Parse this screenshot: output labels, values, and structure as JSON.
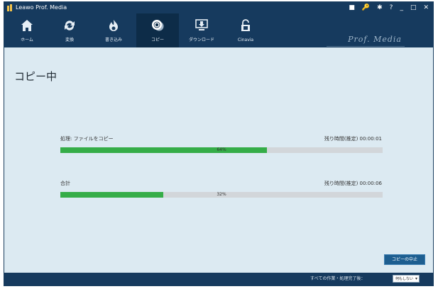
{
  "window": {
    "title": "Leawo Prof. Media"
  },
  "titlebar_icons": [
    {
      "name": "chat-icon",
      "glyph": "■"
    },
    {
      "name": "key-icon",
      "glyph": "🔑"
    },
    {
      "name": "settings-gear-icon",
      "glyph": "✱"
    },
    {
      "name": "help-icon",
      "glyph": "?"
    },
    {
      "name": "minimize-icon",
      "glyph": "_"
    },
    {
      "name": "maximize-icon",
      "glyph": "□"
    },
    {
      "name": "close-icon",
      "glyph": "✕"
    }
  ],
  "nav_tabs": [
    {
      "label": "ホーム",
      "icon": "home-icon"
    },
    {
      "label": "変換",
      "icon": "convert-icon"
    },
    {
      "label": "書き込み",
      "icon": "burn-icon"
    },
    {
      "label": "コピー",
      "icon": "copy-disc-icon",
      "active": true
    },
    {
      "label": "ダウンロード",
      "icon": "download-icon"
    },
    {
      "label": "Cinavia",
      "icon": "cinavia-icon"
    }
  ],
  "brand": "Prof. Media",
  "page": {
    "title": "コピー中"
  },
  "tasks": [
    {
      "label": "処理: ファイルをコピー",
      "time_remaining": "残り時間(推定) 00:00:01",
      "progress": 0.64,
      "progress_text": "64%"
    },
    {
      "label": "合計",
      "time_remaining": "残り時間(推定) 00:00:06",
      "progress": 0.32,
      "progress_text": "32%"
    }
  ],
  "stop_button": "コピーの中止",
  "footer": {
    "after_label": "すべての作業・処理完了後：",
    "after_value": "何もしない"
  },
  "colors": {
    "header": "#163a5e",
    "active_tab": "#0d2c48",
    "content_bg": "#dceaf2",
    "progress_fill": "#35ad48",
    "button": "#1d5e90"
  }
}
